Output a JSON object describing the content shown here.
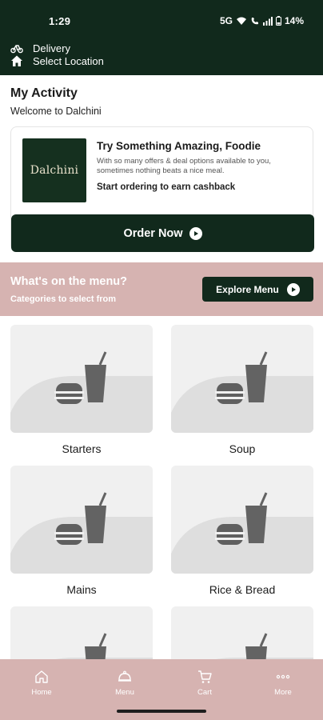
{
  "status_bar": {
    "time": "1:29",
    "battery": "14%",
    "network": "5G"
  },
  "location": {
    "mode_label": "Delivery",
    "location_label": "Select Location"
  },
  "activity": {
    "title": "My Activity",
    "subtitle": "Welcome to Dalchini"
  },
  "promo": {
    "logo_text": "Dalchini",
    "headline": "Try Something Amazing, Foodie",
    "body": "With so many offers & deal options available to you, sometimes nothing beats a nice meal.",
    "cta_note": "Start ordering to earn cashback",
    "order_button": "Order Now"
  },
  "menu_section": {
    "title": "What's on the menu?",
    "subtitle": "Categories to select from",
    "explore_button": "Explore Menu"
  },
  "categories": [
    {
      "label": "Starters"
    },
    {
      "label": "Soup"
    },
    {
      "label": "Mains"
    },
    {
      "label": "Rice & Bread"
    },
    {
      "label": ""
    },
    {
      "label": ""
    }
  ],
  "tabbar": {
    "items": [
      {
        "label": "Home",
        "icon": "home-icon"
      },
      {
        "label": "Menu",
        "icon": "cloche-icon"
      },
      {
        "label": "Cart",
        "icon": "cart-icon"
      },
      {
        "label": "More",
        "icon": "more-icon"
      }
    ]
  },
  "colors": {
    "brand_dark_green": "#11291c",
    "brand_rose": "#d6b3b1",
    "placeholder_gray": "#f0f0f0"
  }
}
